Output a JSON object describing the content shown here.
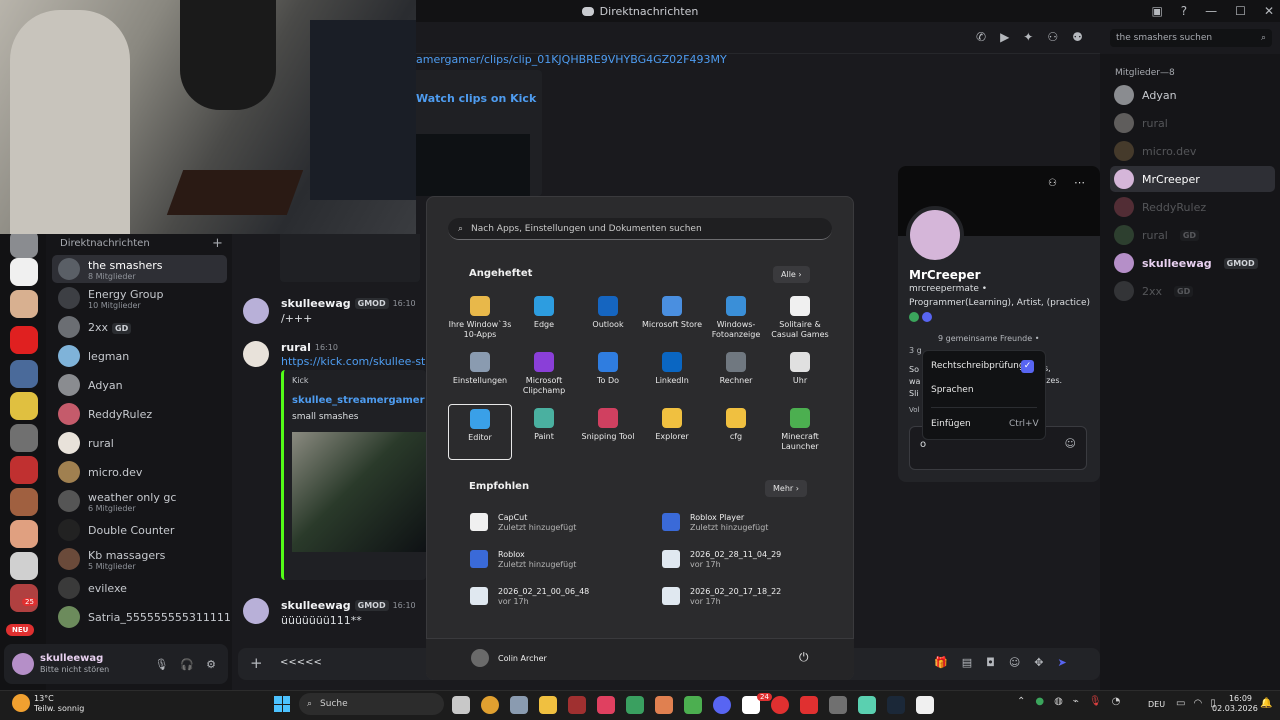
{
  "window": {
    "title": "Direktnachrichten"
  },
  "header": {
    "search_placeholder": "the smashers suchen"
  },
  "dm_section": {
    "title": "Direktnachrichten",
    "add": "+"
  },
  "dms": [
    {
      "name": "the smashers",
      "sub": "8 Mitglieder",
      "color": "#5a5f66",
      "selected": true
    },
    {
      "name": "Energy Group",
      "sub": "10 Mitglieder",
      "color": "#3d3f44"
    },
    {
      "name": "2xx",
      "sub": "",
      "color": "#6b6e73",
      "badge": "GD"
    },
    {
      "name": "legman",
      "sub": "",
      "color": "#7fb3d9"
    },
    {
      "name": "Adyan",
      "sub": "",
      "color": "#8a8c90"
    },
    {
      "name": "ReddyRulez",
      "sub": "",
      "color": "#c55b6b"
    },
    {
      "name": "rural",
      "sub": "",
      "color": "#e8e2da"
    },
    {
      "name": "micro.dev",
      "sub": "",
      "color": "#a08050"
    },
    {
      "name": "weather only gc",
      "sub": "6 Mitglieder",
      "color": "#555"
    },
    {
      "name": "Double Counter",
      "sub": "",
      "color": "#222"
    },
    {
      "name": "Kb massagers",
      "sub": "5 Mitglieder",
      "color": "#6a4a3a"
    },
    {
      "name": "evilexe",
      "sub": "",
      "color": "#3a3a3a"
    },
    {
      "name": "Satria_5555555553111111...",
      "sub": "",
      "color": "#6c8b5c"
    }
  ],
  "rail": {
    "badge_25": "25",
    "new_label": "NEU"
  },
  "user": {
    "name": "skulleewag",
    "status": "Bitte nicht stören"
  },
  "chat": {
    "top_link": "amergamer/clips/clip_01KJQHBRE9VHYBG4GZ02F493MY",
    "embed1_title": "Watch clips on Kick",
    "msg1": {
      "author": "skulleewag",
      "tag": "GMOD",
      "time": "16:10",
      "text": "/+++"
    },
    "msg2": {
      "author": "rural",
      "time": "16:10",
      "link": "https://kick.com/skullee-stream"
    },
    "embed2": {
      "provider": "Kick",
      "title": "skullee_streamergamer - Wa",
      "desc": "small smashes"
    },
    "msg3": {
      "author": "skulleewag",
      "tag": "GMOD",
      "time": "16:10",
      "text": "üüüüüüü111**"
    },
    "composer_text": "<<<<<"
  },
  "members": {
    "header": "Mitglieder—8",
    "list": [
      {
        "name": "Adyan",
        "color": "#8a8c90",
        "dim": false
      },
      {
        "name": "rural",
        "color": "#e8e2da",
        "dim": true
      },
      {
        "name": "micro.dev",
        "color": "#a08050",
        "dim": true
      },
      {
        "name": "MrCreeper",
        "color": "#d5b6d9",
        "dim": false,
        "selected": true
      },
      {
        "name": "ReddyRulez",
        "color": "#c55b6b",
        "dim": true
      },
      {
        "name": "rural",
        "color": "#5c8e5c",
        "dim": true,
        "badge": "GD"
      },
      {
        "name": "skulleewag",
        "color": "#b58fc8",
        "dim": false,
        "badge": "GMOD"
      },
      {
        "name": "2xx",
        "color": "#6b6e73",
        "dim": true,
        "badge": "GD"
      }
    ]
  },
  "profile": {
    "name": "MrCreeper",
    "handle": "mrcreepermate •",
    "bio": "Programmer(Learning), Artist, (practice)",
    "friends": "9 gemeinsame Freunde •",
    "partial1": "3 g",
    "partial2": "So",
    "partial3": "wa",
    "partial4": "Sli",
    "partial5": "Vol",
    "partial6": "s,",
    "partial7": "izes.",
    "input_text": "o"
  },
  "context_menu": {
    "spellcheck": "Rechtschreibprüfung",
    "languages": "Sprachen",
    "paste": "Einfügen",
    "paste_shortcut": "Ctrl+V"
  },
  "start_menu": {
    "search_placeholder": "Nach Apps, Einstellungen und Dokumenten suchen",
    "pinned_title": "Angeheftet",
    "all_button": "Alle",
    "recommended_title": "Empfohlen",
    "more_button": "Mehr",
    "pinned": [
      {
        "label": "Ihre Window`3s 10-Apps",
        "color": "#e8b84a"
      },
      {
        "label": "Edge",
        "color": "#2d9de0"
      },
      {
        "label": "Outlook",
        "color": "#1565c0"
      },
      {
        "label": "Microsoft Store",
        "color": "#4a8fe0"
      },
      {
        "label": "Windows-Fotoanzeige",
        "color": "#3a8fd8"
      },
      {
        "label": "Solitaire & Casual Games",
        "color": "#f0f0f0"
      },
      {
        "label": "Einstellungen",
        "color": "#8a9bb0"
      },
      {
        "label": "Microsoft Clipchamp",
        "color": "#8a3fd8"
      },
      {
        "label": "To Do",
        "color": "#2f7de0"
      },
      {
        "label": "LinkedIn",
        "color": "#0a66c2"
      },
      {
        "label": "Rechner",
        "color": "#707880"
      },
      {
        "label": "Uhr",
        "color": "#e0e0e0"
      },
      {
        "label": "Editor",
        "color": "#3aa0e8",
        "focus": true
      },
      {
        "label": "Paint",
        "color": "#4ab0a0"
      },
      {
        "label": "Snipping Tool",
        "color": "#d04060"
      },
      {
        "label": "Explorer",
        "color": "#f0c040"
      },
      {
        "label": "cfg",
        "color": "#f0c040"
      },
      {
        "label": "Minecraft Launcher",
        "color": "#4caf50"
      }
    ],
    "recommended": [
      {
        "title": "CapCut",
        "sub": "Zuletzt hinzugefügt",
        "color": "#f0f0f0"
      },
      {
        "title": "Roblox Player",
        "sub": "Zuletzt hinzugefügt",
        "color": "#3a6ad8"
      },
      {
        "title": "Roblox",
        "sub": "Zuletzt hinzugefügt",
        "color": "#3a6ad8"
      },
      {
        "title": "2026_02_28_11_04_29",
        "sub": "vor 17h",
        "color": "#e0e8f0"
      },
      {
        "title": "2026_02_21_00_06_48",
        "sub": "vor 17h",
        "color": "#e0e8f0"
      },
      {
        "title": "2026_02_20_17_18_22",
        "sub": "vor 17h",
        "color": "#e0e8f0"
      }
    ],
    "user": "Colin Archer"
  },
  "taskbar": {
    "weather_temp": "13°C",
    "weather_desc": "Teilw. sonnig",
    "search_label": "Suche",
    "lang": "DEU",
    "time": "16:09",
    "date": "02.03.2026",
    "discord_badge": "24"
  }
}
